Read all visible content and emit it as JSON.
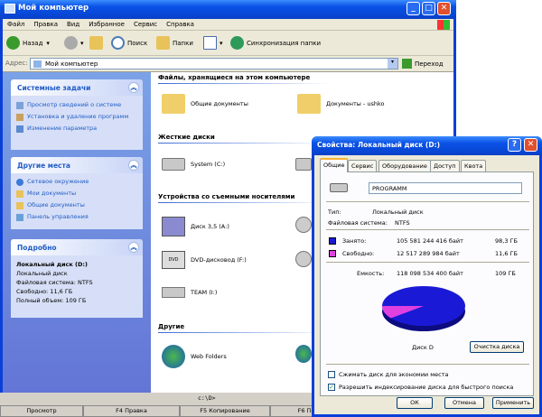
{
  "window": {
    "title": "Мой компьютер"
  },
  "menu": [
    "Файл",
    "Правка",
    "Вид",
    "Избранное",
    "Сервис",
    "Справка"
  ],
  "toolbar": {
    "back": "Назад",
    "search": "Поиск",
    "folders": "Папки",
    "sync": "Синхронизация папки"
  },
  "address": {
    "label": "Адрес:",
    "value": "Мой компьютер",
    "go": "Переход"
  },
  "tasks": {
    "title": "Системные задачи",
    "items": [
      "Просмотр сведений о системе",
      "Установка и удаление программ",
      "Изменение параметра"
    ]
  },
  "places": {
    "title": "Другие места",
    "items": [
      "Сетевое окружение",
      "Мои документы",
      "Общие документы",
      "Панель управления"
    ]
  },
  "details": {
    "title": "Подробно",
    "name": "Локальный диск (D:)",
    "type": "Локальный диск",
    "fs": "Файловая система: NTFS",
    "free": "Свободно: 11,6 ГБ",
    "total": "Полный объем: 109 ГБ"
  },
  "groups": {
    "files": "Файлы, хранящиеся на этом компьютере",
    "hdd": "Жесткие диски",
    "removable": "Устройства со съемными носителями",
    "other": "Другие"
  },
  "items": {
    "shared": "Общие документы",
    "userdocs": "Документы - ushko",
    "system": "System (C:)",
    "floppy": "Диск 3,5 (A:)",
    "dvd": "DVD-дисковод (F:)",
    "team": "TEAM (I:)",
    "web": "Web Folders"
  },
  "cmdline": "c:\\D>",
  "fkeys": [
    "Просмотр",
    "F4 Правка",
    "F5 Копирование",
    "F6 Перенос"
  ],
  "dialog": {
    "title": "Свойства: Локальный диск (D:)",
    "tabs": [
      "Общие",
      "Сервис",
      "Оборудование",
      "Доступ",
      "Квота"
    ],
    "label": "PROGRAMM",
    "type_k": "Тип:",
    "type_v": "Локальный диск",
    "fs_k": "Файловая система:",
    "fs_v": "NTFS",
    "used_k": "Занято:",
    "used_bytes": "105 581 244 416 байт",
    "used_gb": "98,3 ГБ",
    "free_k": "Свободно:",
    "free_bytes": "12 517 289 984 байт",
    "free_gb": "11,6 ГБ",
    "cap_k": "Емкость:",
    "cap_bytes": "118 098 534 400 байт",
    "cap_gb": "109 ГБ",
    "disk_label": "Диск D",
    "cleanup": "Очистка диска",
    "compress": "Сжимать диск для экономии места",
    "index": "Разрешить индексирование диска для быстрого поиска",
    "ok": "ОК",
    "cancel": "Отмена",
    "apply": "Применить",
    "used_color": "#1a1ad6",
    "free_color": "#e040e0"
  }
}
